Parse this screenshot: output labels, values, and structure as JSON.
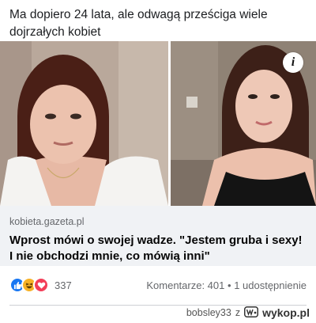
{
  "post": {
    "text": "Ma dopiero 24 lata, ale odwagą prześciga wiele dojrzałych kobiet"
  },
  "link": {
    "domain": "kobieta.gazeta.pl",
    "title": "Wprost mówi o swojej wadze. \"Jestem gruba i sexy! I nie obchodzi mnie, co mówią inni\""
  },
  "photos": {
    "info_glyph": "i"
  },
  "reactions": {
    "count": "337",
    "comments": "Komentarze: 401",
    "separator": "•",
    "shares": "1 udostępnienie",
    "icons": [
      "like-icon",
      "haha-icon",
      "love-icon"
    ]
  },
  "watermark": {
    "user": "bobsley33",
    "joiner": "z",
    "site": "wykop.pl"
  },
  "colors": {
    "like": "#1877f2",
    "haha": "#f7b125",
    "love": "#f33e58",
    "card_bg": "#f0f2f5",
    "muted": "#65676b"
  }
}
